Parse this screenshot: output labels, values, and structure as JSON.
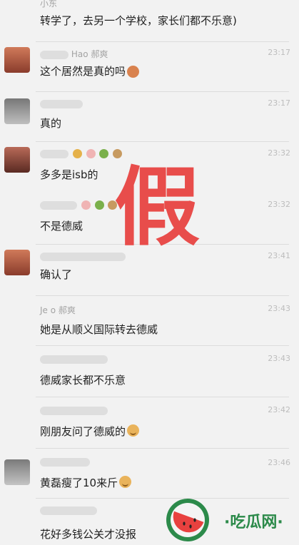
{
  "top": {
    "sender": "小东",
    "text": "转学了，去另一个学校，家长们都不乐意)"
  },
  "messages": [
    {
      "sender": "Hao 郝爽",
      "time": "23:17",
      "text": "这个居然是真的吗"
    },
    {
      "sender": "",
      "time": "23:17",
      "text": "真的"
    },
    {
      "sender": "",
      "time": "23:32",
      "text": "多多是isb的"
    },
    {
      "sender": "",
      "time": "23:32",
      "text": "不是德威"
    },
    {
      "sender": "",
      "time": "23:41",
      "text": "确认了"
    },
    {
      "sender": "Je    o 郝爽",
      "time": "23:43",
      "text": "她是从顺义国际转去德威"
    },
    {
      "sender": "",
      "time": "23:43",
      "text": "德威家长都不乐意"
    },
    {
      "sender": "",
      "time": "23:42",
      "text": "刚朋友问了德威的"
    },
    {
      "sender": "",
      "time": "23:46",
      "text": "黄磊瘦了10来斤"
    },
    {
      "sender": "",
      "time": "",
      "text": "花好多钱公关才没报"
    }
  ],
  "stamp": {
    "text": "假"
  },
  "watermark": {
    "brand": "·吃瓜网·"
  },
  "colors": {
    "stamp": "#e8413f",
    "brand": "#2c8a4a"
  }
}
